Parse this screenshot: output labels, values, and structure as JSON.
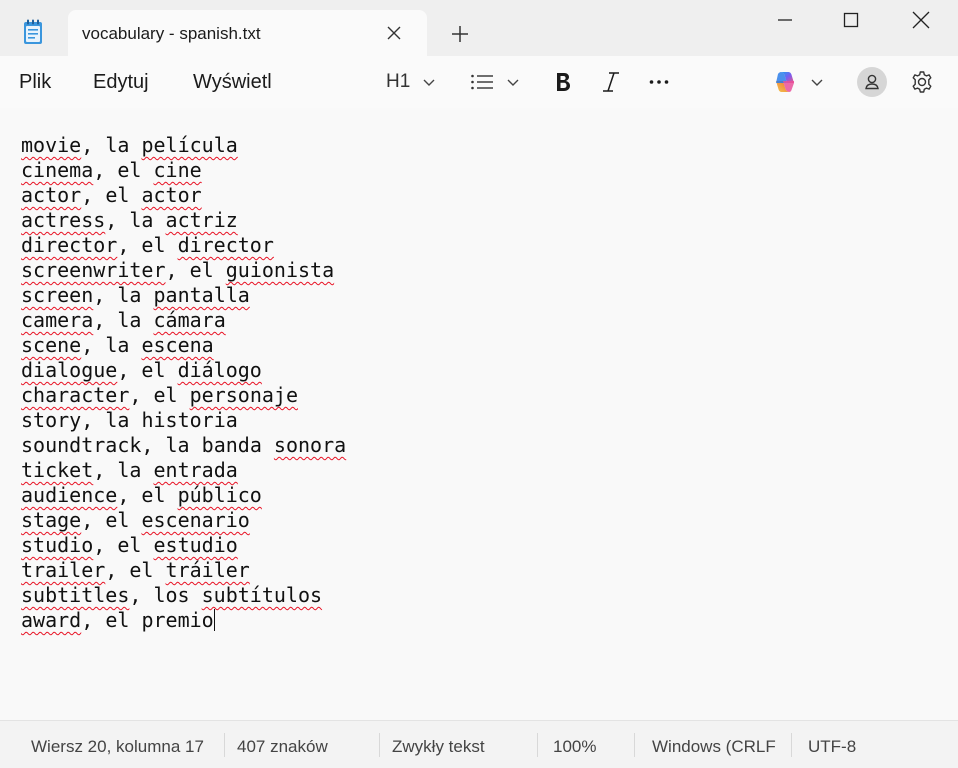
{
  "window": {
    "tab_title": "vocabulary - spanish.txt",
    "controls": [
      "minimize-icon",
      "maximize-icon",
      "close-icon"
    ]
  },
  "menu": {
    "file": "Plik",
    "edit": "Edytuj",
    "view": "Wyświetl"
  },
  "toolbar": {
    "heading": "H1",
    "icons": [
      "list-icon",
      "bold-icon",
      "italic-icon",
      "more-icon",
      "copilot-icon",
      "account-icon",
      "settings-icon"
    ]
  },
  "editor": {
    "lines": [
      "movie, la película",
      "cinema, el cine",
      "actor, el actor",
      "actress, la actriz",
      "director, el director",
      "screenwriter, el guionista",
      "screen, la pantalla",
      "camera, la cámara",
      "scene, la escena",
      "dialogue, el diálogo",
      "character, el personaje",
      "story, la historia",
      "soundtrack, la banda sonora",
      "ticket, la entrada",
      "audience, el público",
      "stage, el escenario",
      "studio, el estudio",
      "trailer, el tráiler",
      "subtitles, los subtítulos",
      "award, el premio"
    ],
    "misspelled": [
      [
        "movie",
        "película"
      ],
      [
        "cinema",
        "cine"
      ],
      [
        "actor",
        "actor"
      ],
      [
        "actress",
        "actriz"
      ],
      [
        "director",
        "director"
      ],
      [
        "screenwriter",
        "guionista"
      ],
      [
        "screen",
        "pantalla"
      ],
      [
        "camera",
        "cámara"
      ],
      [
        "scene",
        "escena"
      ],
      [
        "dialogue",
        "diálogo"
      ],
      [
        "character",
        "personaje"
      ],
      [],
      [
        "sonora"
      ],
      [
        "ticket",
        "entrada"
      ],
      [
        "audience",
        "público"
      ],
      [
        "stage",
        "escenario"
      ],
      [
        "studio",
        "estudio"
      ],
      [
        "trailer",
        "tráiler"
      ],
      [
        "subtitles",
        "subtítulos"
      ],
      [
        "award"
      ]
    ],
    "spellcheck_color": "#e81123"
  },
  "status": {
    "position": "Wiersz 20, kolumna 17",
    "chars": "407 znaków",
    "format": "Zwykły tekst",
    "zoom": "100%",
    "line_ending": "Windows (CRLF",
    "encoding": "UTF-8"
  }
}
